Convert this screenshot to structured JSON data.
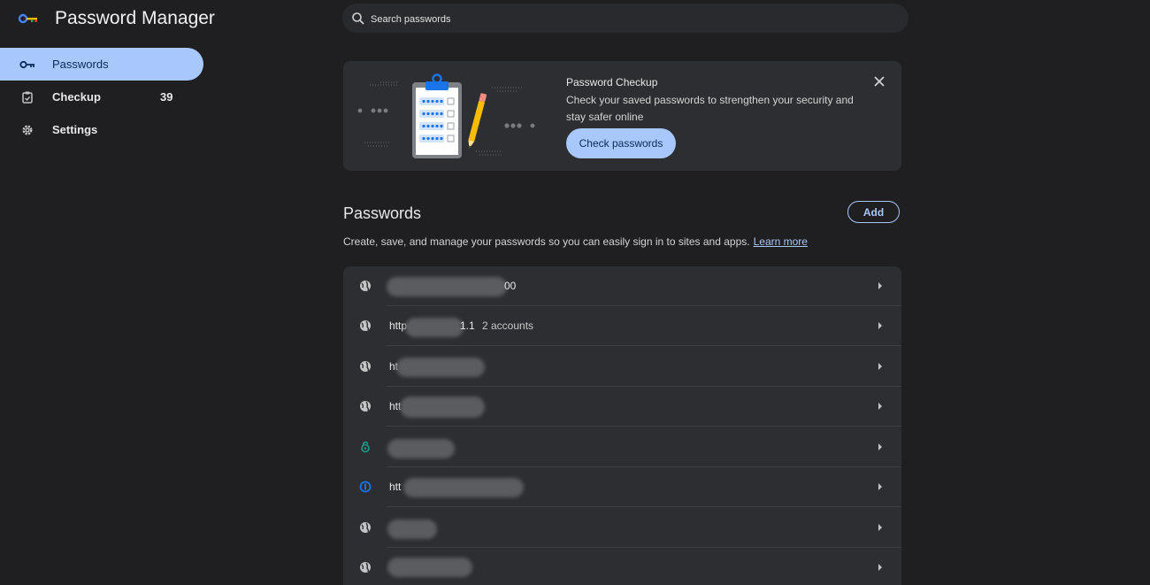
{
  "app": {
    "title": "Password Manager"
  },
  "sidebar": {
    "items": [
      {
        "label": "Passwords",
        "icon": "key-icon",
        "active": true
      },
      {
        "label": "Checkup",
        "icon": "clipboard-check-icon",
        "count": "39"
      },
      {
        "label": "Settings",
        "icon": "gear-icon"
      }
    ]
  },
  "search": {
    "placeholder": "Search passwords"
  },
  "checkup": {
    "title": "Password Checkup",
    "description": "Check your saved passwords to strengthen your security and stay safer online",
    "button_label": "Check passwords"
  },
  "passwords": {
    "title": "Passwords",
    "add_label": "Add",
    "description": "Create, save, and manage your passwords so you can easily sign in to sites and apps.",
    "learn_more": "Learn more",
    "rows": [
      {
        "site": "00",
        "accounts": "",
        "icon": "globe-icon"
      },
      {
        "site": "http",
        "site_suffix": "1.1",
        "accounts": "2 accounts",
        "icon": "globe-icon"
      },
      {
        "site": "ht",
        "accounts": "",
        "icon": "globe-icon"
      },
      {
        "site": "htt",
        "accounts": "",
        "icon": "globe-icon"
      },
      {
        "site": "",
        "accounts": "",
        "icon": "green-lock-icon"
      },
      {
        "site": "htt",
        "accounts": "",
        "icon": "blue-shield-icon"
      },
      {
        "site": "",
        "accounts": "",
        "icon": "globe-icon"
      },
      {
        "site": "",
        "accounts": "",
        "icon": "globe-icon"
      }
    ]
  },
  "colors": {
    "accent": "#a8c7fa",
    "background": "#1f1f21",
    "card": "#2d2e31"
  }
}
